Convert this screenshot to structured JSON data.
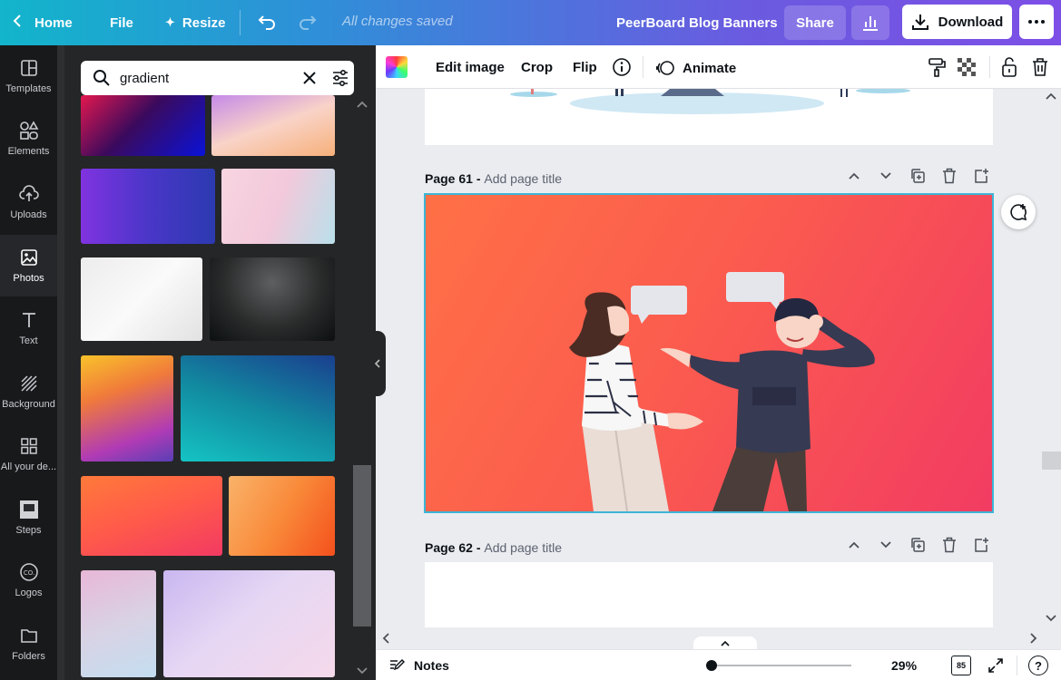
{
  "topbar": {
    "home": "Home",
    "file": "File",
    "resize": "Resize",
    "saved_status": "All changes saved",
    "design_title": "PeerBoard Blog Banners",
    "share": "Share",
    "download": "Download"
  },
  "rail": {
    "items": [
      {
        "label": "Templates",
        "icon": "templates-icon"
      },
      {
        "label": "Elements",
        "icon": "elements-icon"
      },
      {
        "label": "Uploads",
        "icon": "upload-cloud-icon"
      },
      {
        "label": "Photos",
        "icon": "photo-icon"
      },
      {
        "label": "Text",
        "icon": "text-icon"
      },
      {
        "label": "Background",
        "icon": "background-icon"
      },
      {
        "label": "All your de...",
        "icon": "grid-icon"
      },
      {
        "label": "Steps",
        "icon": "steps-icon"
      },
      {
        "label": "Logos",
        "icon": "logo-icon"
      },
      {
        "label": "Folders",
        "icon": "folder-icon"
      }
    ],
    "active": "Photos"
  },
  "search": {
    "value": "gradient",
    "placeholder": "Search photos"
  },
  "context_toolbar": {
    "edit_image": "Edit image",
    "crop": "Crop",
    "flip": "Flip",
    "animate": "Animate"
  },
  "pages": [
    {
      "number_label": "Page 61 -",
      "title_placeholder": "Add page title"
    },
    {
      "number_label": "Page 62 -",
      "title_placeholder": "Add page title"
    }
  ],
  "bottombar": {
    "notes": "Notes",
    "zoom": "29%",
    "page_count": "85",
    "help": "?"
  },
  "colors": {
    "accent_cyan": "#12b5cb",
    "accent_purple": "#7d4fe6",
    "selection": "#3db5d6",
    "banner_orange": "#ff6b47",
    "banner_pink": "#f23a63"
  }
}
